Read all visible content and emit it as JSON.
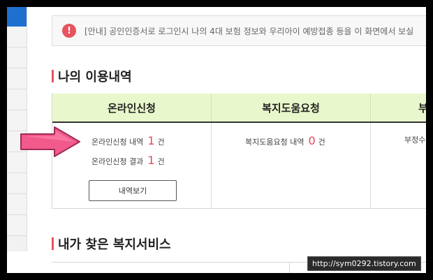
{
  "notice": {
    "icon": "exclamation-icon",
    "text": "[안내] 공인인증서로 로그인시 나의 4대 보험 정보와 우리아이 예방접종 등을 이 화면에서 보실"
  },
  "usage": {
    "title": "나의 이용내역",
    "headers": [
      "온라인신청",
      "복지도움요청",
      "부"
    ],
    "online": {
      "line1_label": "온라인신청 내역",
      "line1_count": "1",
      "line2_label": "온라인신청 결과",
      "line2_count": "1",
      "unit": "건",
      "button": "내역보기"
    },
    "welfare": {
      "label": "복지도움요청 내역",
      "count": "0",
      "unit": "건"
    },
    "third": {
      "label": "부정수"
    }
  },
  "services": {
    "title": "내가 찾은 복지서비스"
  },
  "watermark": "http://sym0292.tistory.com",
  "colors": {
    "accent": "#e8535f",
    "header_bg": "#e9f8cc",
    "count": "#e0485e",
    "arrow": "#f25a8c"
  }
}
